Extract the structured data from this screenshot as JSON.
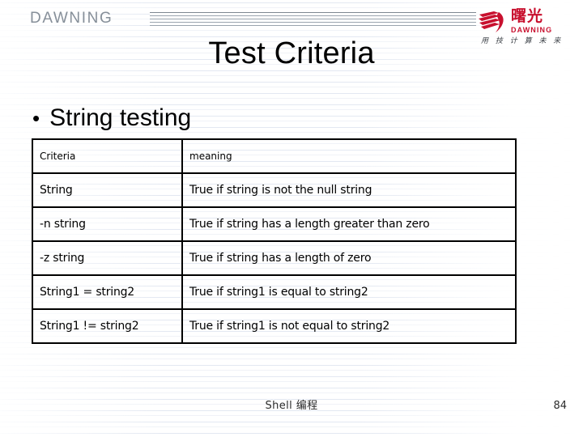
{
  "header": {
    "wordmark": "DAWNING",
    "rule_icon": "horizontal-stripes-icon"
  },
  "logo": {
    "mark_icon": "dawning-swoosh-icon",
    "chinese_name": "曙光",
    "english_name": "DAWNING",
    "tagline": "用 技 计 算 未 来"
  },
  "title": "Test Criteria",
  "bullet": {
    "marker": "•",
    "text": "String testing"
  },
  "table": {
    "columns": [
      "Criteria",
      "meaning"
    ],
    "rows": [
      [
        "String",
        "True if string is not the null string"
      ],
      [
        "-n string",
        "True if string has a length greater than zero"
      ],
      [
        "-z string",
        "True if string has a length of zero"
      ],
      [
        "String1 = string2",
        "True if string1 is equal to string2"
      ],
      [
        "String1 != string2",
        "True if string1 is not equal to string2"
      ]
    ]
  },
  "footer": {
    "center": "Shell 编程",
    "page_number": "84"
  },
  "colors": {
    "brand_red": "#c8102e",
    "wordmark_gray": "#868f99",
    "text_black": "#000000",
    "background": "#ffffff"
  }
}
